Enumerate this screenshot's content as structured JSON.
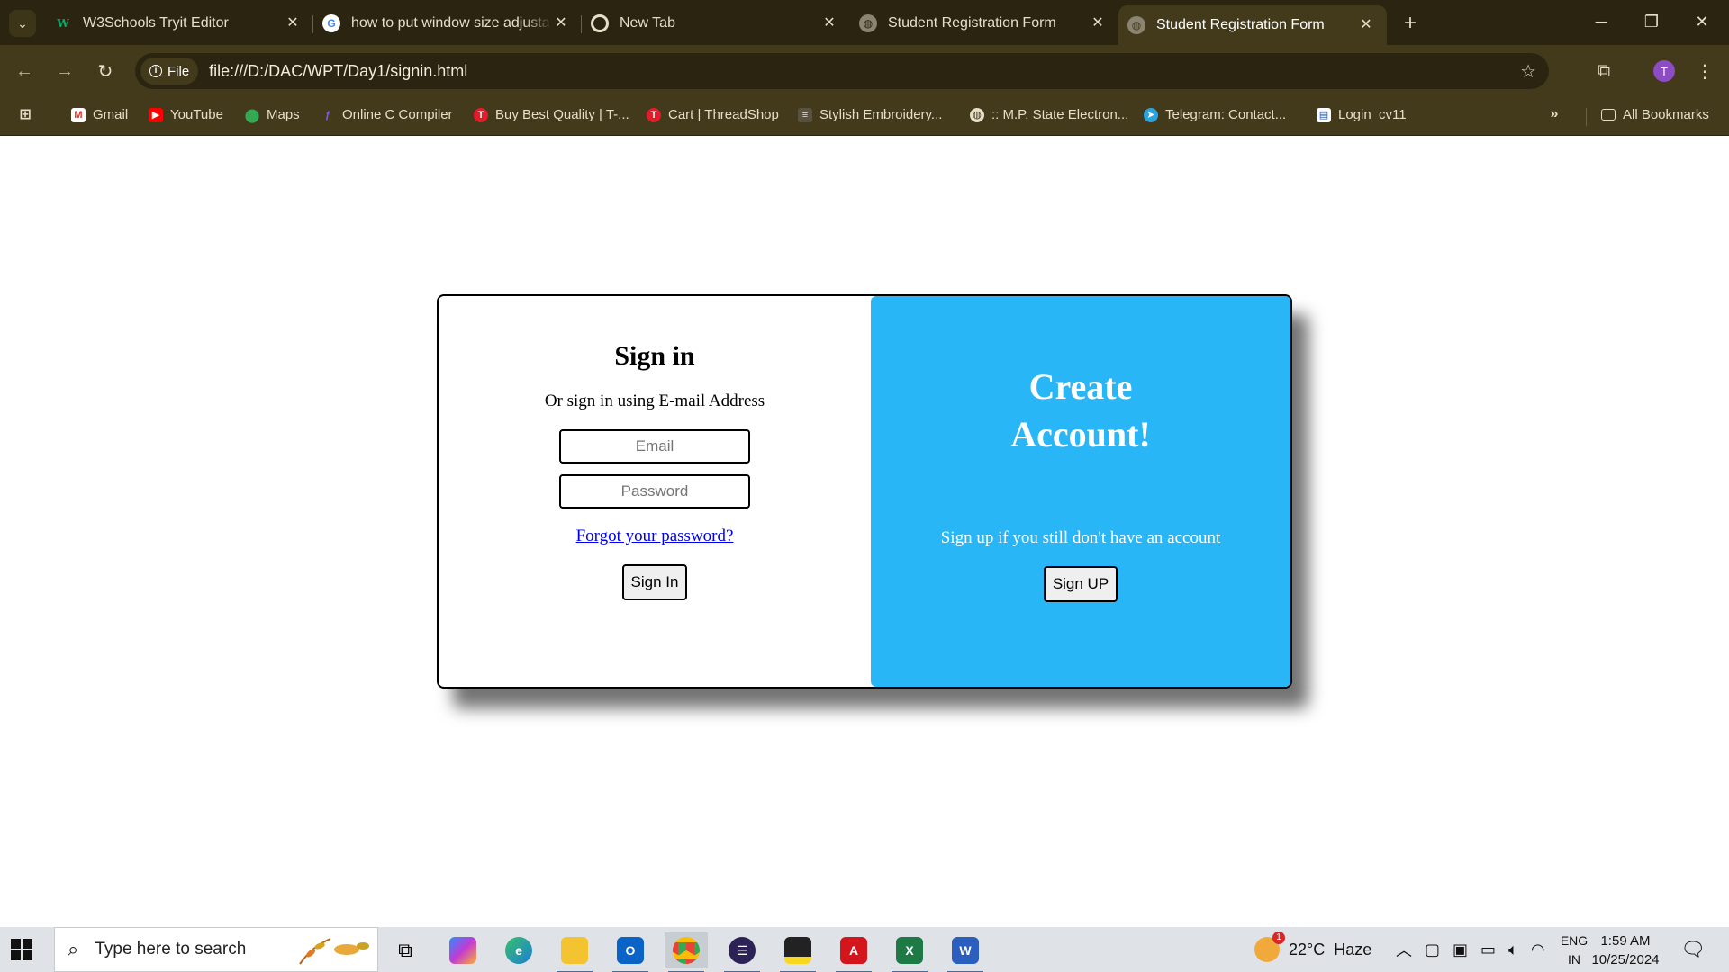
{
  "browser": {
    "tabs": [
      {
        "title": "W3Schools Tryit Editor",
        "favicon": "w3schools-icon",
        "active": false
      },
      {
        "title": "how to put window size adjusta",
        "favicon": "google-icon",
        "active": false
      },
      {
        "title": "New Tab",
        "favicon": "chrome-icon",
        "active": false
      },
      {
        "title": "Student Registration Form",
        "favicon": "globe-icon",
        "active": false
      },
      {
        "title": "Student Registration Form",
        "favicon": "globe-icon",
        "active": true
      }
    ],
    "address": {
      "chip_label": "File",
      "url": "file:///D:/DAC/WPT/Day1/signin.html"
    },
    "profile_initial": "T",
    "bookmarks": [
      {
        "label": "Gmail",
        "icon": "gmail-icon"
      },
      {
        "label": "YouTube",
        "icon": "youtube-icon"
      },
      {
        "label": "Maps",
        "icon": "maps-icon"
      },
      {
        "label": "Online C Compiler",
        "icon": "compiler-icon"
      },
      {
        "label": "Buy Best Quality | T-...",
        "icon": "shop-icon"
      },
      {
        "label": "Cart | ThreadShop",
        "icon": "threadshop-icon"
      },
      {
        "label": "Stylish Embroidery...",
        "icon": "embroidery-icon"
      },
      {
        "label": ":: M.P. State Electron...",
        "icon": "globe-icon"
      },
      {
        "label": "Telegram: Contact...",
        "icon": "telegram-icon"
      },
      {
        "label": "Login_cv11",
        "icon": "login-icon"
      }
    ],
    "all_bookmarks_label": "All Bookmarks"
  },
  "signin": {
    "heading": "Sign in",
    "subtext": "Or sign in using E-mail Address",
    "email_placeholder": "Email",
    "password_placeholder": "Password",
    "forgot_link": "Forgot your password?",
    "submit_label": "Sign In"
  },
  "create": {
    "heading": "Create Account!",
    "subtext": "Sign up if you still don't have an account",
    "button_label": "Sign UP",
    "background": "#29b6f6"
  },
  "taskbar": {
    "search_placeholder": "Type here to search",
    "weather": "22°C  Haze",
    "weather_badge": "1",
    "lang_top": "ENG",
    "lang_bottom": "IN",
    "time": "1:59 AM",
    "date": "10/25/2024"
  }
}
